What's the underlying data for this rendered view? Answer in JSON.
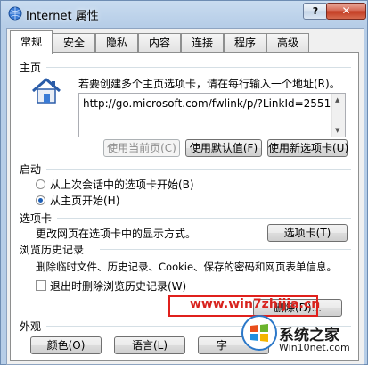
{
  "window": {
    "title": "Internet 属性",
    "help_label": "?",
    "close_label": "✕"
  },
  "tabs": [
    "常规",
    "安全",
    "隐私",
    "内容",
    "连接",
    "程序",
    "高级"
  ],
  "homepage": {
    "section_title": "主页",
    "instruction": "若要创建多个主页选项卡，请在每行输入一个地址(R)。",
    "url": "http://go.microsoft.com/fwlink/p/?LinkId=2551",
    "buttons": [
      "使用当前页(C)",
      "使用默认值(F)",
      "使用新选项卡(U)"
    ]
  },
  "startup": {
    "section_title": "启动",
    "options": [
      "从上次会话中的选项卡开始(B)",
      "从主页开始(H)"
    ],
    "selected_index": 1
  },
  "tabs_section": {
    "section_title": "选项卡",
    "description": "更改网页在选项卡中的显示方式。",
    "button": "选项卡(T)"
  },
  "history": {
    "section_title": "浏览历史记录",
    "description": "删除临时文件、历史记录、Cookie、保存的密码和网页表单信息。",
    "checkbox_label": "退出时删除浏览历史记录(W)",
    "checkbox_checked": false,
    "delete_button": "删除(D)..."
  },
  "appearance": {
    "section_title": "外观",
    "buttons": [
      "颜色(O)",
      "语言(L)",
      "字"
    ]
  },
  "watermarks": {
    "url_text": "www.win7zhijia.cn",
    "logo_text": "系统之家",
    "logo_sub": "Win10net.com"
  }
}
